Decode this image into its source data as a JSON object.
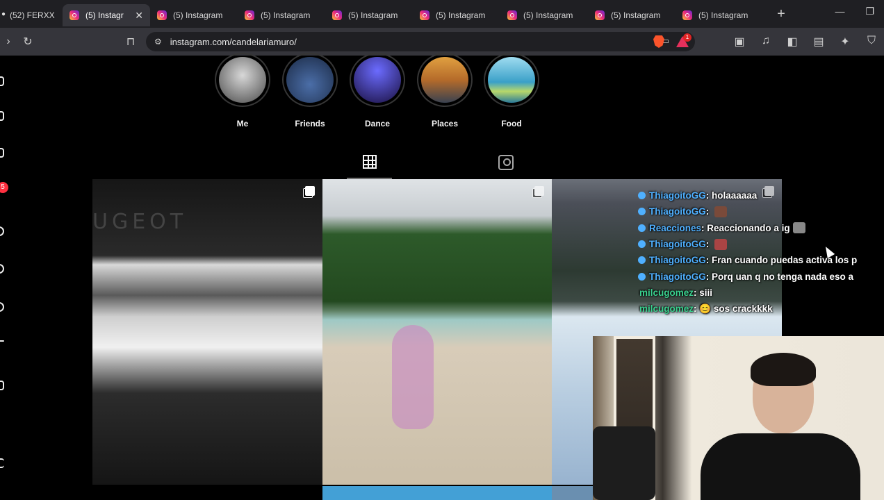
{
  "browser": {
    "tabs": [
      {
        "label": "(52) FERXX",
        "active": false,
        "favicon": "youtube-icon"
      },
      {
        "label": "(5) Instagr",
        "active": true,
        "favicon": "instagram-icon"
      },
      {
        "label": "(5) Instagram",
        "active": false,
        "favicon": "instagram-icon"
      },
      {
        "label": "(5) Instagram",
        "active": false,
        "favicon": "instagram-icon"
      },
      {
        "label": "(5) Instagram",
        "active": false,
        "favicon": "instagram-icon"
      },
      {
        "label": "(5) Instagram",
        "active": false,
        "favicon": "instagram-icon"
      },
      {
        "label": "(5) Instagram",
        "active": false,
        "favicon": "instagram-icon"
      },
      {
        "label": "(5) Instagram",
        "active": false,
        "favicon": "instagram-icon"
      },
      {
        "label": "(5) Instagram",
        "active": false,
        "favicon": "instagram-icon"
      }
    ],
    "url": "instagram.com/candelariamuro/",
    "extension_badge": "1"
  },
  "instagram": {
    "notification_count": "5",
    "highlights": [
      {
        "label": "Me"
      },
      {
        "label": "Friends"
      },
      {
        "label": "Dance"
      },
      {
        "label": "Places"
      },
      {
        "label": "Food"
      }
    ],
    "profile_tabs": [
      {
        "name": "posts-grid",
        "icon": "grid-icon",
        "selected": true
      },
      {
        "name": "tagged",
        "icon": "tagged-person-icon",
        "selected": false
      }
    ],
    "post_text": "UGEOT"
  },
  "stream_chat": [
    {
      "user": "ThiagoitoGG",
      "message": "holaaaaaa",
      "color": "#4fb0ff"
    },
    {
      "user": "ThiagoitoGG",
      "message": "",
      "color": "#4fb0ff"
    },
    {
      "user": "Reacciones",
      "message": "Reaccionando a ig",
      "color": "#4fb0ff"
    },
    {
      "user": "ThiagoitoGG",
      "message": "",
      "color": "#4fb0ff"
    },
    {
      "user": "ThiagoitoGG",
      "message": "Fran cuando puedas activa los p",
      "color": "#4fb0ff"
    },
    {
      "user": "ThiagoitoGG",
      "message": "Porq uan q no tenga nada eso a",
      "color": "#4fb0ff"
    },
    {
      "user": "milcugomez",
      "message": "siii",
      "color": "#3ad18f"
    },
    {
      "user": "milcugomez",
      "message": "😊 sos crackkkk",
      "color": "#3ad18f"
    }
  ]
}
